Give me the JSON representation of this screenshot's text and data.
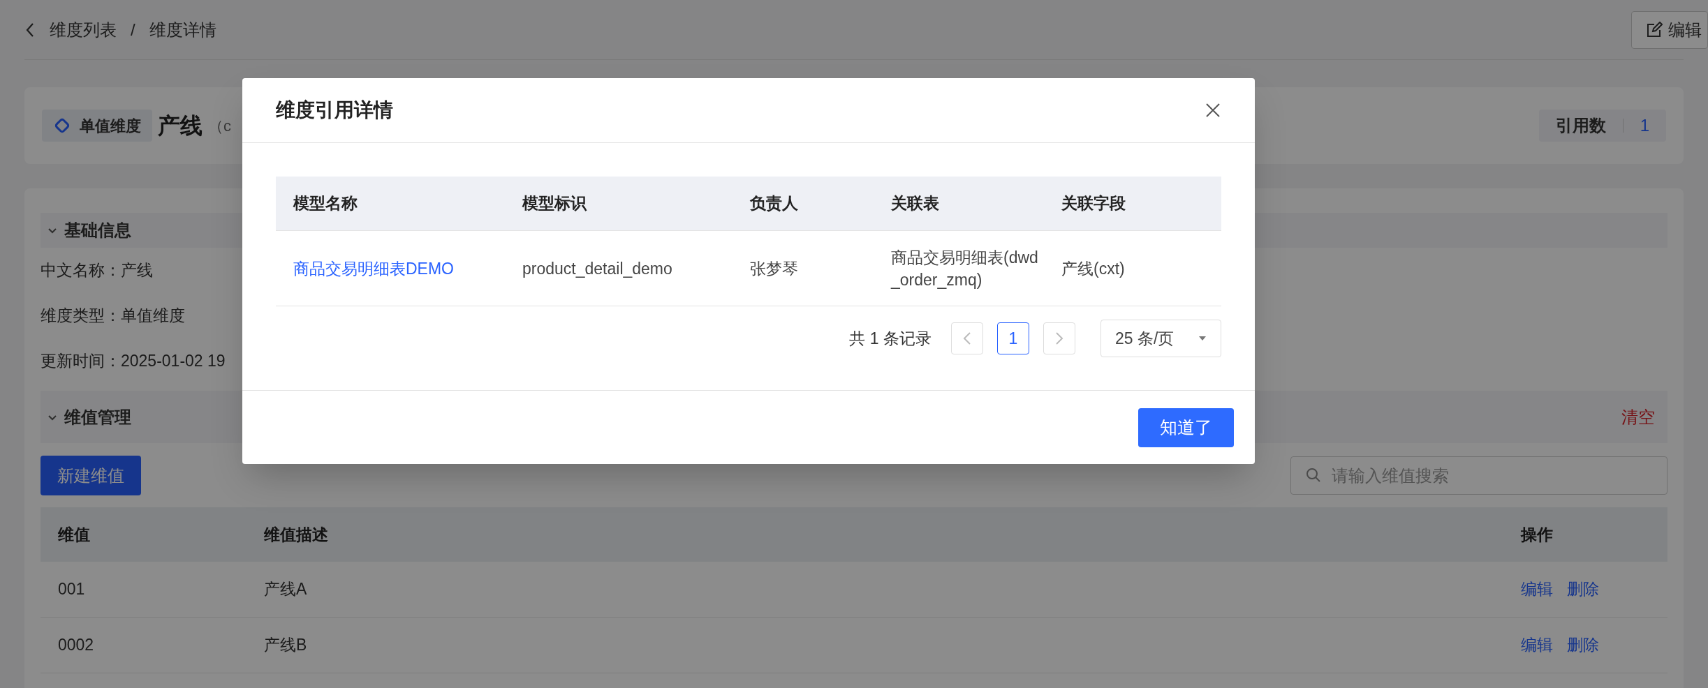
{
  "breadcrumb": {
    "items": [
      "维度列表",
      "维度详情"
    ],
    "separator": "/"
  },
  "edit_button": "编辑",
  "header": {
    "type_badge": "单值维度",
    "name": "产线",
    "code_prefix": "（c",
    "reference_label": "引用数",
    "reference_count": "1"
  },
  "basic_info": {
    "title": "基础信息",
    "expanded": true,
    "fields": [
      "中文名称：产线",
      "维度类型：单值维度",
      "更新时间：2025-01-02 19"
    ]
  },
  "value_management": {
    "title": "维值管理",
    "expanded": true,
    "clear": "清空",
    "new_button": "新建维值",
    "search": {
      "placeholder": "请输入维值搜索"
    },
    "table": {
      "columns": [
        "维值",
        "维值描述",
        "操作"
      ],
      "rows": [
        {
          "value": "001",
          "description": "产线A",
          "actions": [
            "编辑",
            "删除"
          ]
        },
        {
          "value": "0002",
          "description": "产线B",
          "actions": [
            "编辑",
            "删除"
          ]
        }
      ]
    }
  },
  "dialog": {
    "title": "维度引用详情",
    "table": {
      "columns": [
        "模型名称",
        "模型标识",
        "负责人",
        "关联表",
        "关联字段"
      ],
      "rows": [
        {
          "cells": [
            "商品交易明细表DEMO",
            "product_detail_demo",
            "张梦琴",
            "商品交易明细表(dwd_order_zmq)",
            "产线(cxt)"
          ]
        }
      ]
    },
    "pagination": {
      "total": "共 1 条记录",
      "pages": [
        {
          "label": "1",
          "selected": true
        }
      ],
      "page_size": "25 条/页"
    },
    "confirm_button": "知道了"
  }
}
